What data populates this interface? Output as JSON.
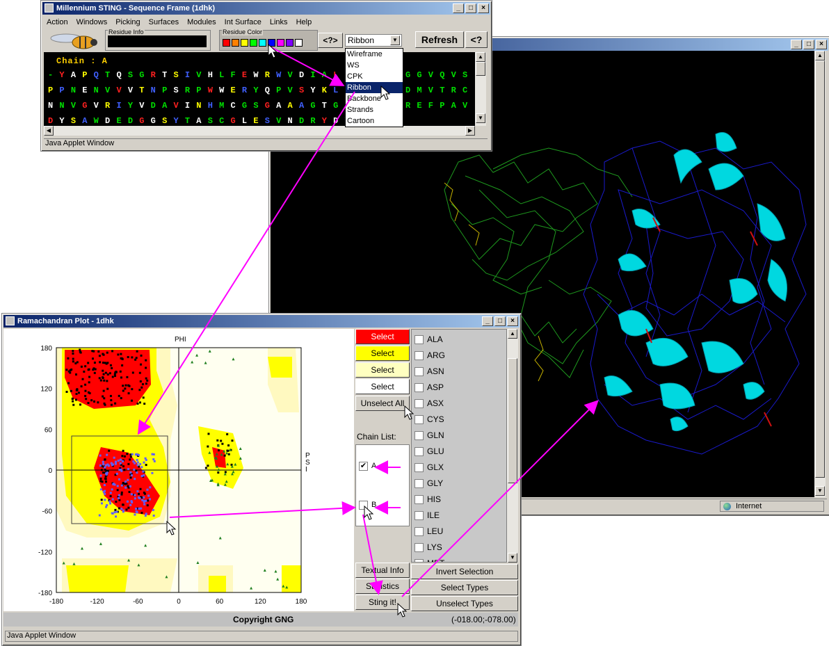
{
  "seq_window": {
    "title": "Millennium STING - Sequence Frame (1dhk)",
    "menu": [
      "Action",
      "Windows",
      "Picking",
      "Surfaces",
      "Modules",
      "Int Surface",
      "Links",
      "Help"
    ],
    "residue_info_label": "Residue Info",
    "residue_color_label": "Residue Color",
    "help_btn": "<?>",
    "render_select": "Ribbon",
    "refresh_btn": "Refresh",
    "help_btn2": "<?",
    "chain_label": "Chain : A",
    "seq_lines": [
      "- Y A P Q T Q S G R T S I V H L F E W R W V D I A L E C E R Y",
      "P P N E N V V V T N P S R P W W E R Y Q P V S Y K L C T R S G",
      "N N V G V R I Y V D A V I N H M C G S G A A A G T G T T C G S",
      "D Y S A W D E D G G S Y T A S C G L E S V N D R Y D V"
    ],
    "seq_right": [
      "G G V Q V S",
      "D M V T R C",
      "R E F P A V"
    ],
    "dropdown_options": [
      "Wireframe",
      "WS",
      "CPK",
      "Ribbon",
      "Backbone",
      "Strands",
      "Cartoon"
    ],
    "dropdown_selected": "Ribbon",
    "status": "Java Applet Window",
    "swatches": [
      "#ff0000",
      "#ff8000",
      "#ffff00",
      "#00ff00",
      "#00ffff",
      "#0000ff",
      "#ff00ff",
      "#8000ff",
      "#ffffff"
    ]
  },
  "mol_window": {
    "status_zone": "Internet"
  },
  "rama_window": {
    "title": "Ramachandran Plot - 1dhk",
    "phi_label": "PHI",
    "psi_label": "P\nS\nI",
    "x_ticks": [
      "-180",
      "-120",
      "-60",
      "0",
      "60",
      "120",
      "180"
    ],
    "y_ticks": [
      "180",
      "120",
      "60",
      "0",
      "-60",
      "-120",
      "-180"
    ],
    "select_buttons": [
      "Select",
      "Select",
      "Select",
      "Select"
    ],
    "select_colors": [
      "#ff0000",
      "#ffff00",
      "#ffffc0",
      "#ffffff"
    ],
    "unselect_all": "Unselect All",
    "chain_list_label": "Chain List:",
    "chains": [
      {
        "name": "A",
        "checked": true
      },
      {
        "name": "B",
        "checked": false
      }
    ],
    "residue_types": [
      "ALA",
      "ARG",
      "ASN",
      "ASP",
      "ASX",
      "CYS",
      "GLN",
      "GLU",
      "GLX",
      "GLY",
      "HIS",
      "ILE",
      "LEU",
      "LYS",
      "MET"
    ],
    "textual_info": "Textual Info",
    "statistics": "Statistics",
    "sting_it": "Sting it!",
    "invert_selection": "Invert Selection",
    "select_types": "Select Types",
    "unselect_types": "Unselect Types",
    "copyright": "Copyright GNG",
    "coords": "(-018.00;-078.00)",
    "status": "Java Applet Window"
  }
}
